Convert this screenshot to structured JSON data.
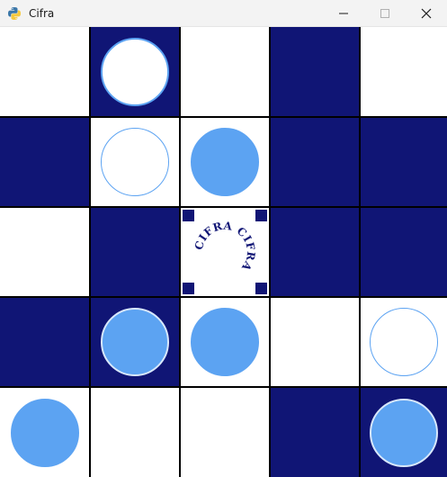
{
  "window": {
    "title": "Cifra",
    "icon": "python-icon",
    "controls": [
      "minimize-icon",
      "maximize-icon",
      "close-icon"
    ]
  },
  "board": {
    "rows": 5,
    "cols": 5,
    "colors": {
      "dark": "#101575",
      "light": "#ffffff",
      "grid": "#000000",
      "piece": "#5ca3f2"
    },
    "cells": [
      [
        "light",
        "dark",
        "light",
        "dark",
        "light"
      ],
      [
        "dark",
        "light",
        "light",
        "dark",
        "dark"
      ],
      [
        "light",
        "dark",
        "center",
        "dark",
        "dark"
      ],
      [
        "dark",
        "dark",
        "light",
        "light",
        "light"
      ],
      [
        "light",
        "light",
        "light",
        "dark",
        "dark"
      ]
    ],
    "pieces": [
      [
        "none",
        "empty",
        "none",
        "none",
        "none"
      ],
      [
        "none",
        "empty",
        "filled",
        "none",
        "none"
      ],
      [
        "none",
        "none",
        "none",
        "none",
        "none"
      ],
      [
        "none",
        "filled",
        "filled",
        "none",
        "empty"
      ],
      [
        "filled",
        "none",
        "none",
        "none",
        "filled"
      ]
    ]
  },
  "center_logo": {
    "text": "CIFRA CIFRA"
  }
}
